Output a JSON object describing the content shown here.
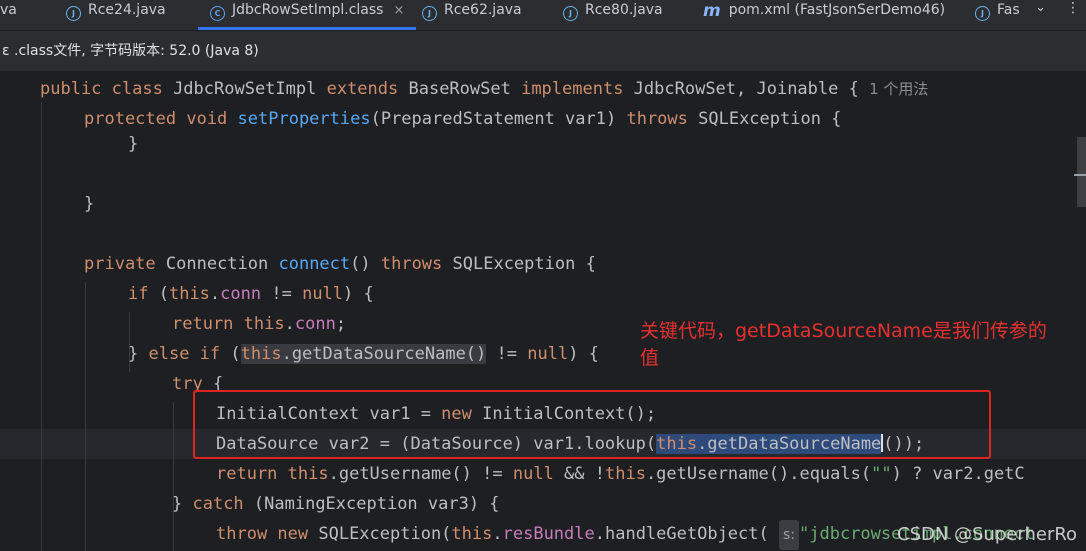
{
  "tabs": [
    {
      "label": "va",
      "icon": "java-file-icon",
      "active": false
    },
    {
      "label": "Rce24.java",
      "icon": "java-file-icon",
      "active": false
    },
    {
      "label": "JdbcRowSetImpl.class",
      "icon": "class-file-icon",
      "active": true
    },
    {
      "label": "Rce62.java",
      "icon": "java-file-icon",
      "active": false
    },
    {
      "label": "Rce80.java",
      "icon": "java-file-icon",
      "active": false
    },
    {
      "label": "pom.xml (FastJsonSerDemo46)",
      "icon": "maven-icon",
      "active": false
    },
    {
      "label": "Fas",
      "icon": "java-file-icon",
      "active": false
    }
  ],
  "tab_close_symbol": "×",
  "tab_overflow_symbol": "⌄",
  "tab_more_symbol": "⋮",
  "info_bar": "ɛ .class文件, 字节码版本: 52.0 (Java 8)",
  "inline_hint": "1 个用法",
  "param_hint": "s:",
  "code": {
    "l1_a": "public class ",
    "l1_b": "JdbcRowSetImpl ",
    "l1_c": "extends ",
    "l1_d": "BaseRowSet ",
    "l1_e": "implements ",
    "l1_f": "JdbcRowSet, Joinable {",
    "l2_a": "protected void ",
    "l2_b": "setProperties",
    "l2_c": "(PreparedStatement var1) ",
    "l2_d": "throws ",
    "l2_e": "SQLException {",
    "l3": "}",
    "l4": "}",
    "l5_a": "private ",
    "l5_b": "Connection ",
    "l5_c": "connect",
    "l5_d": "() ",
    "l5_e": "throws ",
    "l5_f": "SQLException {",
    "l6_a": "if ",
    "l6_b": "(",
    "l6_c": "this",
    "l6_d": ".",
    "l6_e": "conn",
    "l6_f": " != ",
    "l6_g": "null",
    "l6_h": ") {",
    "l7_a": "return ",
    "l7_b": "this",
    "l7_c": ".",
    "l7_d": "conn",
    "l7_e": ";",
    "l8_a": "} ",
    "l8_b": "else if ",
    "l8_c": "(",
    "l8_d": "this",
    "l8_e": ".getDataSourceName()",
    "l8_f": " != ",
    "l8_g": "null",
    "l8_h": ") {",
    "l9_a": "try ",
    "l9_b": "{",
    "l10_a": "InitialContext var1 = ",
    "l10_b": "new ",
    "l10_c": "InitialContext();",
    "l11_a": "DataSource var2 = (DataSource) var1.lookup(",
    "l11_b": "this",
    "l11_c": ".getDataSourceName",
    "l11_d": "());",
    "l12_a": "return ",
    "l12_b": "this",
    "l12_c": ".getUsername() != ",
    "l12_d": "null ",
    "l12_e": "&& !",
    "l12_f": "this",
    "l12_g": ".getUsername().equals(",
    "l12_h": "\"\"",
    "l12_i": ") ? var2.getC",
    "l13_a": "} ",
    "l13_b": "catch ",
    "l13_c": "(NamingException var3) {",
    "l14_a": "throw new ",
    "l14_b": "SQLException(",
    "l14_c": "this",
    "l14_d": ".",
    "l14_e": "resBundle",
    "l14_f": ".handleGetObject( ",
    "l14_g": "\"jdbcrowsetimpl.connect"
  },
  "annotation": "关键代码，getDataSourceName是我们传参的值",
  "watermark": "CSDN @SuperherRo"
}
